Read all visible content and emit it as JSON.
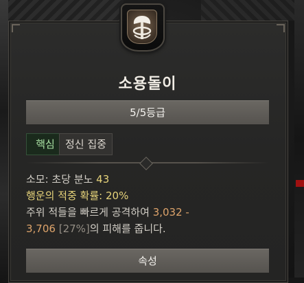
{
  "skill": {
    "icon": "axe-whirlwind-icon",
    "name": "소용돌이",
    "rank": "5/5등급",
    "tags": [
      "핵심",
      "정신 집중"
    ],
    "cost": {
      "label": "소모: 초당 분노",
      "value": "43"
    },
    "lucky_hit": {
      "label": "행운의 적중 확률:",
      "value": "20%"
    },
    "description": {
      "prefix": "주위 적들을 빠르게 공격하여",
      "damage_min": "3,032",
      "dash": "-",
      "damage_max": "3,706",
      "weapon_pct": "[27%]",
      "suffix": "의 피해를 줍니다."
    },
    "attributes_label": "속성"
  },
  "colors": {
    "core_tag": "#a9e1a3",
    "cost_value": "#e6d37a",
    "damage_value": "#dea46b",
    "panel_bg": "#262625"
  }
}
